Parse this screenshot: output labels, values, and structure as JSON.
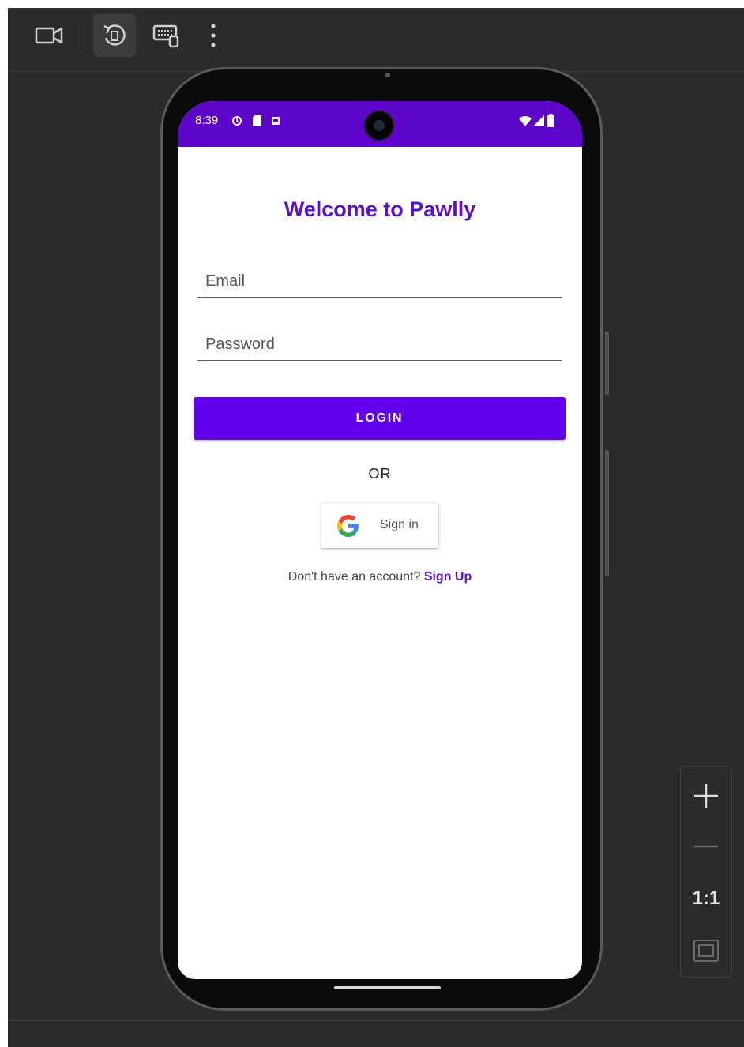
{
  "toolbar": {
    "items": [
      {
        "icon": "video-camera-icon"
      },
      {
        "icon": "rotate-icon"
      },
      {
        "icon": "keyboard-icon"
      },
      {
        "icon": "more-vertical-icon"
      }
    ]
  },
  "zoom": {
    "zoom_in_icon": "plus-icon",
    "zoom_out_icon": "minus-icon",
    "actual_size_label": "1:1",
    "fit_screen_icon": "fit-screen-icon"
  },
  "status_bar": {
    "time": "8:39",
    "icons": [
      "alarm-icon",
      "sd-card-icon",
      "notification-icon",
      "wifi-icon",
      "signal-icon",
      "battery-icon"
    ]
  },
  "app": {
    "title": "Welcome to Pawlly",
    "email_placeholder": "Email",
    "password_placeholder": "Password",
    "login_label": "LOGIN",
    "or_label": "OR",
    "google_sign_in_label": "Sign in",
    "signup_prompt": "Don't have an account? ",
    "signup_link": "Sign Up"
  },
  "colors": {
    "accent": "#6200ee",
    "status_bar": "#5d06c9",
    "title": "#5a0fc8",
    "emulator_bg": "#2b2b2b"
  }
}
